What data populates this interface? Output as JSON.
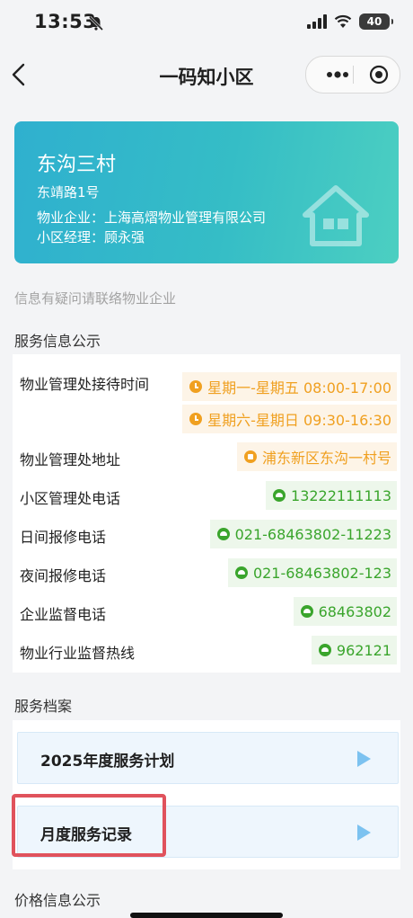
{
  "status_bar": {
    "time": "13:53",
    "battery": "40"
  },
  "nav": {
    "title": "一码知小区"
  },
  "community": {
    "name": "东沟三村",
    "address": "东靖路1号",
    "company_line": "物业企业：上海高熠物业管理有限公司",
    "manager_line": "小区经理：顾永强"
  },
  "hint": "信息有疑问请联络物业企业",
  "service_info": {
    "title": "服务信息公示",
    "reception_label": "物业管理处接待时间",
    "reception_hours": [
      "星期一-星期五 08:00-17:00",
      "星期六-星期日 09:30-16:30"
    ],
    "office_address_label": "物业管理处地址",
    "office_address": "浦东新区东沟一村号",
    "office_phone_label": "小区管理处电话",
    "office_phone": "13222111113",
    "day_repair_label": "日间报修电话",
    "day_repair_phone": "021-68463802-11223",
    "night_repair_label": "夜间报修电话",
    "night_repair_phone": "021-68463802-123",
    "supervision_label": "企业监督电话",
    "supervision_phone": "68463802",
    "hotline_label": "物业行业监督热线",
    "hotline_phone": "962121"
  },
  "archive": {
    "title": "服务档案",
    "items": [
      {
        "label": "2025年度服务计划"
      },
      {
        "label": "月度服务记录"
      }
    ]
  },
  "price": {
    "title": "价格信息公示"
  },
  "colors": {
    "accent_orange": "#f0a020",
    "accent_green": "#3aa52c",
    "hero": "#35bdc6",
    "highlight": "#e0525c"
  }
}
